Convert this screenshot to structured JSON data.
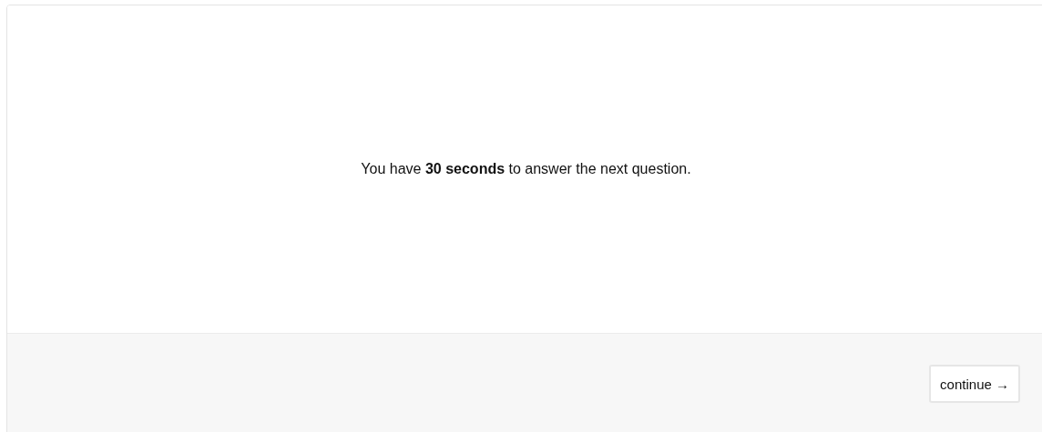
{
  "message": "You have **30 seconds** to answer the next question.",
  "buttons": [
    {
      "label": "continue →"
    }
  ]
}
